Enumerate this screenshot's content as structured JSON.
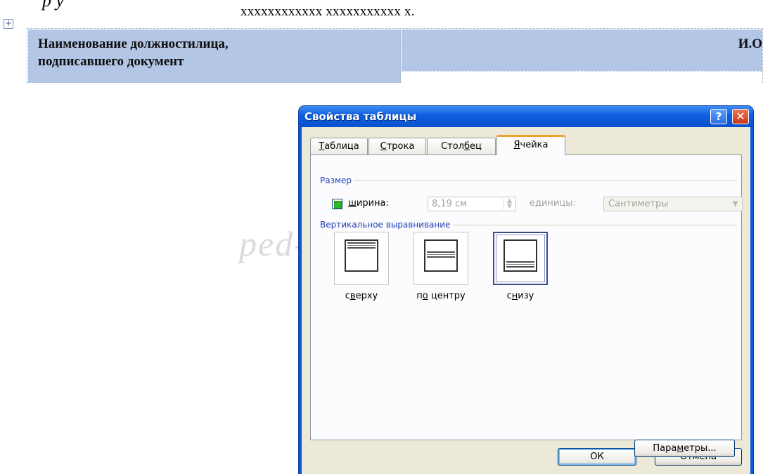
{
  "document": {
    "cut_text": "р             у",
    "date_line": "xxxxxxxxxxxx  xxxxxxxxxxx  x.",
    "table": {
      "left_cell_line1": "Наименование должностилица,",
      "left_cell_line2": "подписавшего документ",
      "right_cell_text": "И.О"
    },
    "watermark": "ped-kopilka.ru"
  },
  "dialog": {
    "title": "Свойства таблицы",
    "help_label": "?",
    "close_label": "✕",
    "tabs": [
      {
        "pre": "",
        "key": "Т",
        "post": "аблица",
        "active": false
      },
      {
        "pre": "",
        "key": "С",
        "post": "трока",
        "active": false
      },
      {
        "pre": "Стол",
        "key": "б",
        "post": "ец",
        "active": false
      },
      {
        "pre": "",
        "key": "Я",
        "post": "чейка",
        "active": true
      }
    ],
    "size_group": {
      "label": "Размер",
      "width_checkbox_checked": true,
      "width_label_key": "ш",
      "width_label_rest": "ирина:",
      "width_value": "8,19 см",
      "units_label": "единицы:",
      "units_value": "Сантиметры"
    },
    "valign_group": {
      "label": "Вертикальное выравнивание",
      "options": [
        {
          "pre": "с",
          "key": "в",
          "post": "ерху",
          "selected": false
        },
        {
          "pre": "п",
          "key": "о",
          "post": " центру",
          "selected": false
        },
        {
          "pre": "с",
          "key": "н",
          "post": "изу",
          "selected": true
        }
      ]
    },
    "buttons": {
      "params_pre": "Пара",
      "params_key": "м",
      "params_post": "етры...",
      "ok": "ОК",
      "cancel": "Отмена"
    }
  }
}
